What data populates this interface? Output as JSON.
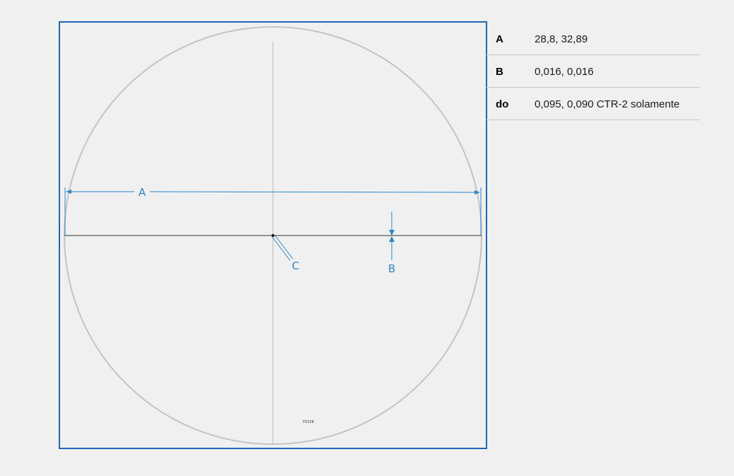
{
  "colors": {
    "frame": "#1f66b8",
    "dimension": "#2d86c8",
    "reticle": "#c4c4c4",
    "crosshair": "#5a5a5a",
    "background": "#f0f0f0"
  },
  "diagram": {
    "labels": {
      "a": "A",
      "b": "B",
      "c": "C",
      "tiny_text": "F0158"
    }
  },
  "specs": [
    {
      "key": "A",
      "value": "28,8, 32,89"
    },
    {
      "key": "B",
      "value": "0,016, 0,016"
    },
    {
      "key": "do",
      "value": "0,095, 0,090 CTR-2 solamente"
    }
  ]
}
